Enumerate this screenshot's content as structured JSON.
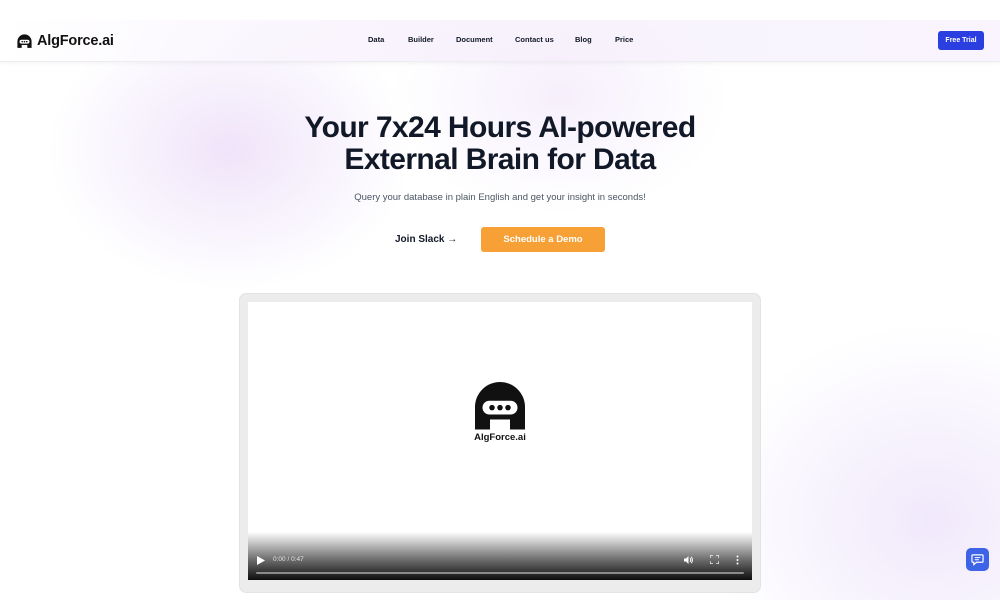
{
  "brand": {
    "name": "AlgForce.ai",
    "accent_color": "#2b3fe0",
    "cta_color": "#f7a035"
  },
  "nav": {
    "items": [
      {
        "label": "Data"
      },
      {
        "label": "Builder"
      },
      {
        "label": "Document"
      },
      {
        "label": "Contact us"
      },
      {
        "label": "Blog"
      },
      {
        "label": "Price"
      }
    ],
    "cta_label": "Free Trial"
  },
  "hero": {
    "title_line1": "Your 7x24 Hours AI-powered",
    "title_line2": "External Brain for Data",
    "subtitle": "Query your database in plain English and get your insight in seconds!",
    "secondary_cta": "Join Slack →",
    "primary_cta": "Schedule a Demo"
  },
  "video": {
    "brand_label": "AlgForce.ai",
    "time": "0:00 / 0:47",
    "progress": 0,
    "icons": [
      "play-icon",
      "volume-icon",
      "fullscreen-icon",
      "more-options-icon"
    ]
  },
  "chat": {
    "icon": "chat-icon",
    "color": "#3d63e6"
  }
}
